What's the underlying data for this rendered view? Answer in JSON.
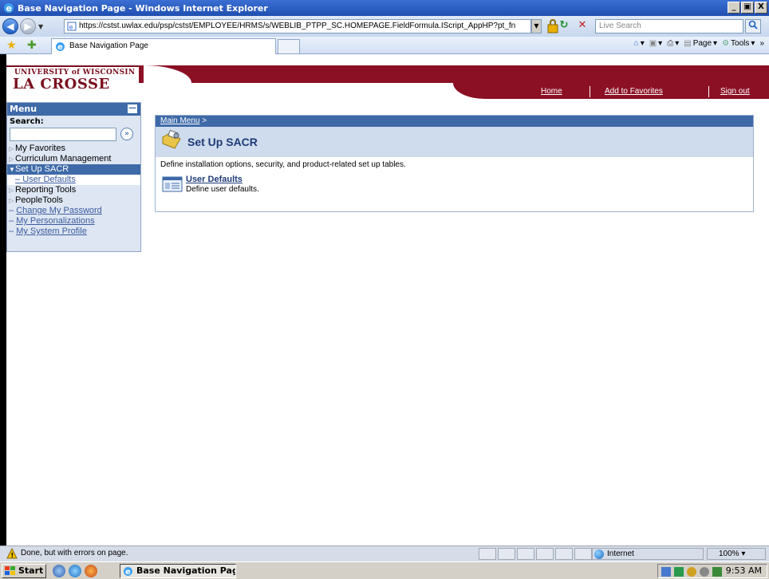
{
  "window": {
    "title": "Base Navigation Page - Windows Internet Explorer",
    "minimize": "_",
    "restore": "ɑ",
    "close": "X"
  },
  "address": {
    "url": "https://cstst.uwlax.edu/psp/cstst/EMPLOYEE/HRMS/s/WEBLIB_PTPP_SC.HOMEPAGE.FieldFormula.IScript_AppHP?pt_fn",
    "search_placeholder": "Live Search"
  },
  "tabs": {
    "active_tab": "Base Navigation Page",
    "cmd_page": "Page",
    "cmd_tools": "Tools"
  },
  "site": {
    "logo_top": "UNIVERSITY of WISCONSIN",
    "logo_main": "LA CROSSE",
    "links": {
      "home": "Home",
      "favorites": "Add to Favorites",
      "signout": "Sign out"
    }
  },
  "menu": {
    "title": "Menu",
    "search_label": "Search:",
    "items": [
      {
        "label": "My Favorites"
      },
      {
        "label": "Curriculum Management"
      },
      {
        "label": "Set Up SACR"
      },
      {
        "label": "User Defaults"
      },
      {
        "label": "Reporting Tools"
      },
      {
        "label": "PeopleTools"
      },
      {
        "label": "Change My Password"
      },
      {
        "label": "My Personalizations"
      },
      {
        "label": "My System Profile"
      }
    ]
  },
  "content": {
    "breadcrumb": "Main Menu",
    "breadcrumb_sep": " >",
    "title": "Set Up SACR",
    "description": "Define installation options, security, and product-related set up tables.",
    "items": [
      {
        "label": "User Defaults",
        "description": "Define user defaults."
      }
    ]
  },
  "status": {
    "text": "Done, but with errors on page.",
    "zone": "Internet",
    "zoom": "100%"
  },
  "taskbar": {
    "start": "Start",
    "task": "Base Navigation Page...",
    "clock": "9:53 AM"
  },
  "colors": {
    "maroon": "#8c1024",
    "menu_blue": "#3e6aa8",
    "title_blue": "#1f4fb0"
  }
}
